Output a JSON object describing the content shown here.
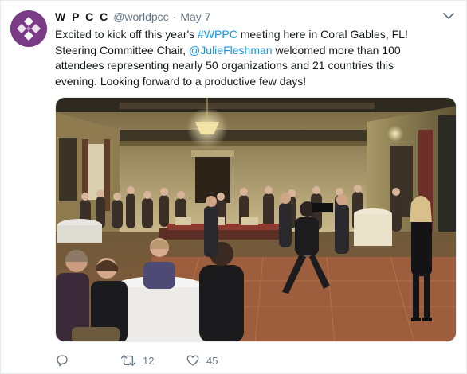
{
  "tweet": {
    "display_name": "W P C C",
    "handle": "@worldpcc",
    "separator": "·",
    "date": "May 7",
    "text_parts": {
      "p1": "Excited to kick off this year's ",
      "hashtag": "#WPPC",
      "p2": " meeting here in Coral Gables, FL! Steering Committee Chair, ",
      "mention": "@JulieFleshman",
      "p3": " welcomed more than 100 attendees representing nearly 50 organizations and 21 countries this evening. Looking forward to a productive few days!"
    },
    "media": {
      "alt": "Photo of attendees seated at round tables in an ornate ballroom while a speaker in black addresses the room and a videographer films"
    },
    "actions": {
      "reply_count": "",
      "retweet_count": "12",
      "like_count": "45"
    }
  },
  "colors": {
    "link": "#1b95e0",
    "secondary_text": "#657786",
    "avatar_bg": "#7a3b86",
    "border": "#e6ecf0"
  },
  "icons": {
    "avatar": "wppc-logo-icon",
    "menu": "chevron-down-icon",
    "reply": "reply-icon",
    "retweet": "retweet-icon",
    "like": "heart-icon"
  }
}
